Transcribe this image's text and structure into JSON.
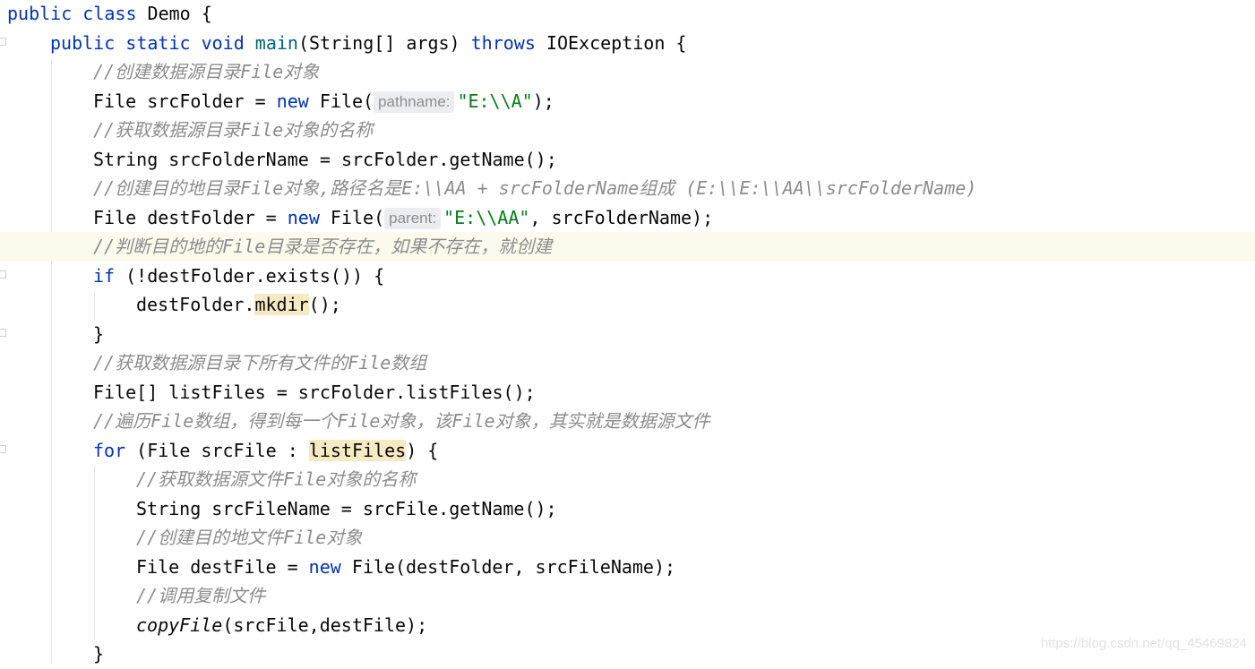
{
  "editor": {
    "lines": [
      {
        "indent": 0,
        "current": false,
        "tokens": [
          {
            "t": "public class ",
            "c": "kw"
          },
          {
            "t": "Demo {",
            "c": ""
          }
        ]
      },
      {
        "indent": 1,
        "current": false,
        "tokens": [
          {
            "t": "public static void ",
            "c": "kw"
          },
          {
            "t": "main",
            "c": "fn"
          },
          {
            "t": "(String[] args) ",
            "c": ""
          },
          {
            "t": "throws ",
            "c": "kw"
          },
          {
            "t": "IOException {",
            "c": ""
          }
        ]
      },
      {
        "indent": 2,
        "current": false,
        "tokens": [
          {
            "t": "//创建数据源目录File对象",
            "c": "cm"
          }
        ]
      },
      {
        "indent": 2,
        "current": false,
        "tokens": [
          {
            "t": "File srcFolder = ",
            "c": ""
          },
          {
            "t": "new ",
            "c": "kw"
          },
          {
            "t": "File(",
            "c": ""
          },
          {
            "t": "pathname:",
            "c": "hint"
          },
          {
            "t": "\"E:\\\\A\"",
            "c": "str"
          },
          {
            "t": ");",
            "c": ""
          }
        ]
      },
      {
        "indent": 2,
        "current": false,
        "tokens": [
          {
            "t": "//获取数据源目录File对象的名称",
            "c": "cm"
          }
        ]
      },
      {
        "indent": 2,
        "current": false,
        "tokens": [
          {
            "t": "String srcFolderName = srcFolder.getName();",
            "c": ""
          }
        ]
      },
      {
        "indent": 2,
        "current": false,
        "tokens": [
          {
            "t": "//创建目的地目录File对象,路径名是E:\\\\AA + srcFolderName组成 (E:\\\\E:\\\\AA\\\\srcFolderName)",
            "c": "cm"
          }
        ]
      },
      {
        "indent": 2,
        "current": false,
        "tokens": [
          {
            "t": "File destFolder = ",
            "c": ""
          },
          {
            "t": "new ",
            "c": "kw"
          },
          {
            "t": "File(",
            "c": ""
          },
          {
            "t": "parent:",
            "c": "hint"
          },
          {
            "t": "\"E:\\\\AA\"",
            "c": "str"
          },
          {
            "t": ", srcFolderName);",
            "c": ""
          }
        ]
      },
      {
        "indent": 2,
        "current": true,
        "tokens": [
          {
            "t": "//判断目的地的File目录是否存在，如果不存在，就创建",
            "c": "cm"
          }
        ]
      },
      {
        "indent": 2,
        "current": false,
        "tokens": [
          {
            "t": "if ",
            "c": "kw"
          },
          {
            "t": "(!destFolder.exists()) {",
            "c": ""
          }
        ]
      },
      {
        "indent": 3,
        "current": false,
        "tokens": [
          {
            "t": "destFolder.",
            "c": ""
          },
          {
            "t": "mkdir",
            "c": "hl"
          },
          {
            "t": "();",
            "c": ""
          }
        ]
      },
      {
        "indent": 2,
        "current": false,
        "tokens": [
          {
            "t": "}",
            "c": ""
          }
        ]
      },
      {
        "indent": 2,
        "current": false,
        "tokens": [
          {
            "t": "//获取数据源目录下所有文件的File数组",
            "c": "cm"
          }
        ]
      },
      {
        "indent": 2,
        "current": false,
        "tokens": [
          {
            "t": "File[] listFiles = srcFolder.listFiles();",
            "c": ""
          }
        ]
      },
      {
        "indent": 2,
        "current": false,
        "tokens": [
          {
            "t": "//遍历File数组，得到每一个File对象，该File对象，其实就是数据源文件",
            "c": "cm"
          }
        ]
      },
      {
        "indent": 2,
        "current": false,
        "tokens": [
          {
            "t": "for ",
            "c": "kw"
          },
          {
            "t": "(File srcFile : ",
            "c": ""
          },
          {
            "t": "listFiles",
            "c": "hl"
          },
          {
            "t": ") {",
            "c": ""
          }
        ]
      },
      {
        "indent": 3,
        "current": false,
        "tokens": [
          {
            "t": "//获取数据源文件File对象的名称",
            "c": "cm"
          }
        ]
      },
      {
        "indent": 3,
        "current": false,
        "tokens": [
          {
            "t": "String srcFileName = srcFile.getName();",
            "c": ""
          }
        ]
      },
      {
        "indent": 3,
        "current": false,
        "tokens": [
          {
            "t": "//创建目的地文件File对象",
            "c": "cm"
          }
        ]
      },
      {
        "indent": 3,
        "current": false,
        "tokens": [
          {
            "t": "File destFile = ",
            "c": ""
          },
          {
            "t": "new ",
            "c": "kw"
          },
          {
            "t": "File(destFolder, srcFileName);",
            "c": ""
          }
        ]
      },
      {
        "indent": 3,
        "current": false,
        "tokens": [
          {
            "t": "//调用复制文件",
            "c": "cm"
          }
        ]
      },
      {
        "indent": 3,
        "current": false,
        "tokens": [
          {
            "t": "copyFile",
            "c": "it"
          },
          {
            "t": "(srcFile,destFile);",
            "c": ""
          }
        ]
      },
      {
        "indent": 2,
        "current": false,
        "tokens": [
          {
            "t": "}",
            "c": ""
          }
        ]
      }
    ]
  },
  "watermark": "https://blog.csdn.net/qq_45469824"
}
